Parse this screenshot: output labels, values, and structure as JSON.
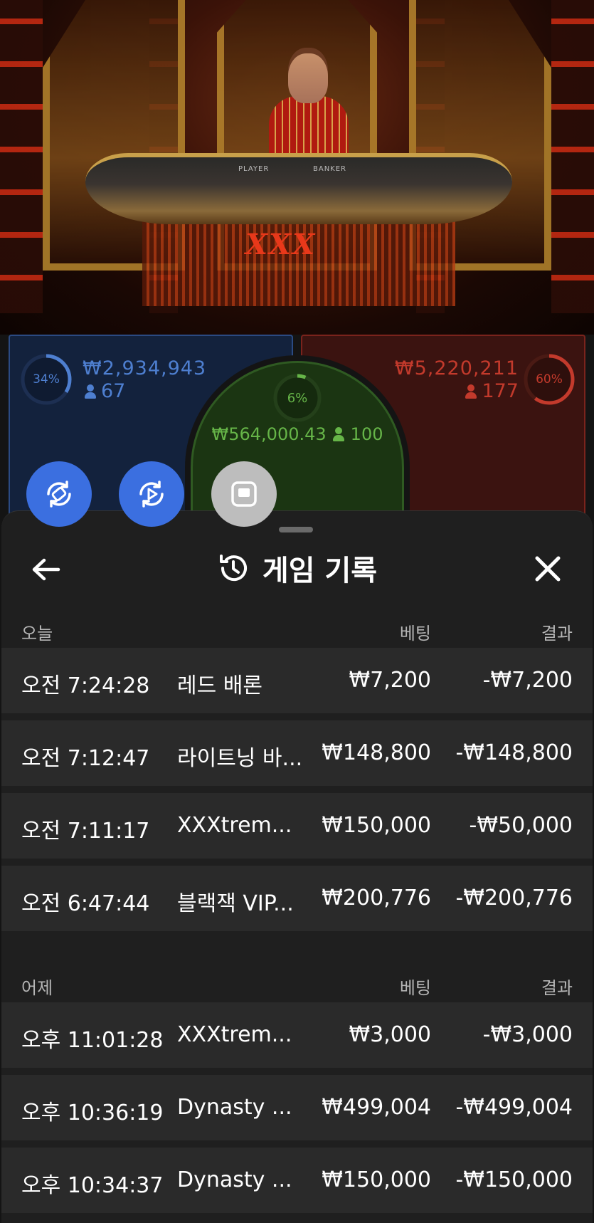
{
  "bets": {
    "player": {
      "percent": "34%",
      "amount": "₩2,934,943",
      "players": "67",
      "color": "#4e7fd0"
    },
    "tie": {
      "percent": "6%",
      "amount": "₩564,000.43",
      "players": "100",
      "color": "#66b548"
    },
    "banker": {
      "percent": "60%",
      "amount": "₩5,220,211",
      "players": "177",
      "color": "#c33a2c"
    }
  },
  "table_labels": {
    "player": "PLAYER",
    "banker": "BANKER",
    "brand": "XXX"
  },
  "fab_buttons": [
    {
      "icon": "rotate-chip-icon"
    },
    {
      "icon": "rotate-play-icon"
    },
    {
      "icon": "stop-square-icon"
    }
  ],
  "header": {
    "title": "게임 기록",
    "back_icon": "arrow-left-icon",
    "history_icon": "history-icon",
    "close_icon": "close-icon"
  },
  "sections": [
    {
      "label": "오늘",
      "bet_label": "베팅",
      "result_label": "결과",
      "rows": [
        {
          "time": "오전 7:24:28",
          "game": "레드 배론",
          "bet": "₩7,200",
          "result": "-₩7,200"
        },
        {
          "time": "오전 7:12:47",
          "game": "라이트닝 바...",
          "bet": "₩148,800",
          "result": "-₩148,800"
        },
        {
          "time": "오전 7:11:17",
          "game": "XXXtrem...",
          "bet": "₩150,000",
          "result": "-₩50,000"
        },
        {
          "time": "오전 6:47:44",
          "game": "블랙잭 VIP...",
          "bet": "₩200,776",
          "result": "-₩200,776"
        }
      ]
    },
    {
      "label": "어제",
      "bet_label": "베팅",
      "result_label": "결과",
      "rows": [
        {
          "time": "오후 11:01:28",
          "game": "XXXtrem...",
          "bet": "₩3,000",
          "result": "-₩3,000"
        },
        {
          "time": "오후 10:36:19",
          "game": "Dynasty ...",
          "bet": "₩499,004",
          "result": "-₩499,004"
        },
        {
          "time": "오후 10:34:37",
          "game": "Dynasty ...",
          "bet": "₩150,000",
          "result": "-₩150,000"
        }
      ]
    }
  ]
}
